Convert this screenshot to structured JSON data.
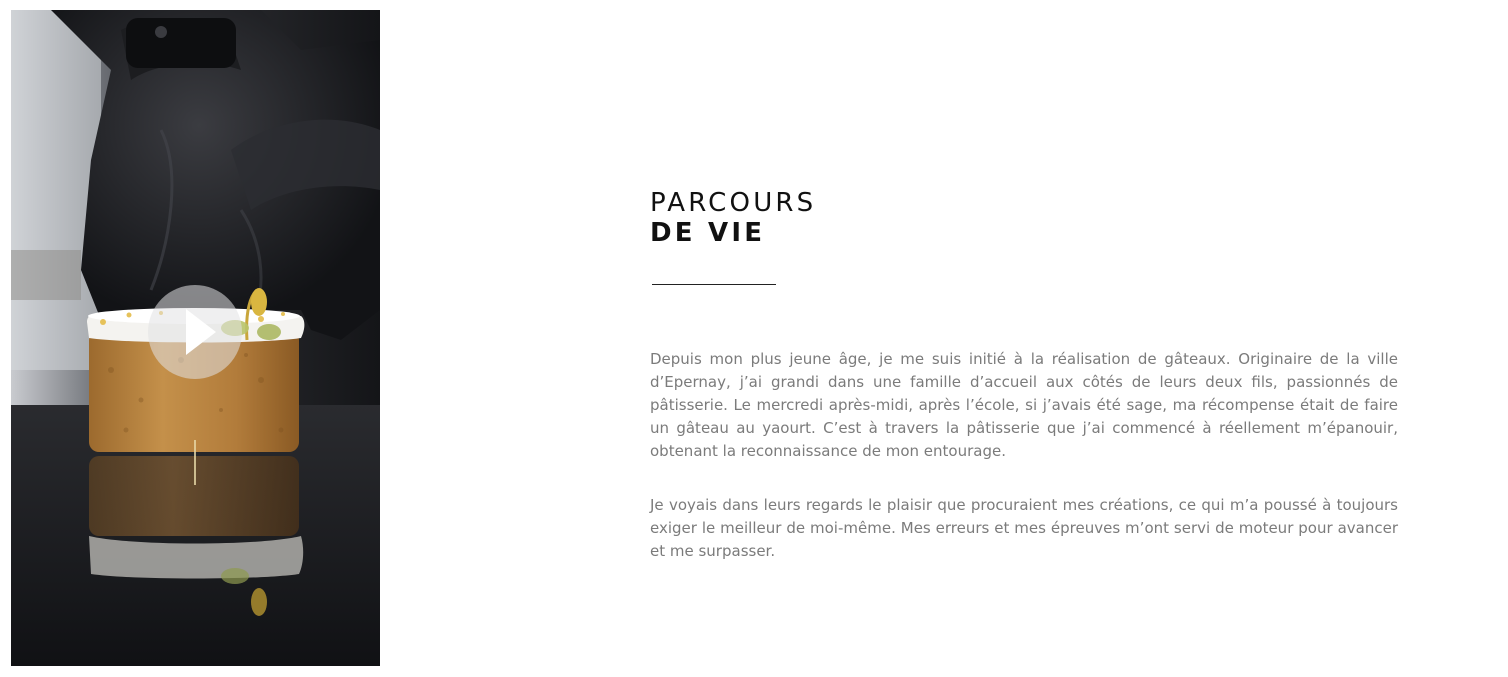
{
  "video": {
    "play_icon": "play-icon",
    "colors": {
      "background": "#1a1b1e",
      "play_overlay": "#e1e1e4"
    }
  },
  "section": {
    "title_line_1": "PARCOURS",
    "title_line_2": "DE VIE",
    "paragraphs": [
      "Depuis mon plus jeune âge, je me suis initié à la réalisation de gâteaux. Originaire de la ville d’Epernay, j’ai grandi dans une famille d’accueil aux côtés de leurs deux fils, passionnés de pâtisserie. Le mercredi après-midi, après l’école, si j’avais été sage, ma récompense était de faire un gâteau au yaourt. C’est à travers la pâtisserie que j’ai commencé à réellement m’épanouir, obtenant la reconnaissance de mon entourage.",
      "Je voyais dans leurs regards le plaisir que procuraient mes créations, ce qui m’a poussé à toujours exiger le meilleur de moi-même. Mes erreurs et mes épreuves m’ont servi de moteur pour avancer et me surpasser."
    ]
  },
  "colors": {
    "title": "#111111",
    "body_text": "#7b7b7b",
    "rule": "#222222",
    "page_background": "#ffffff"
  }
}
